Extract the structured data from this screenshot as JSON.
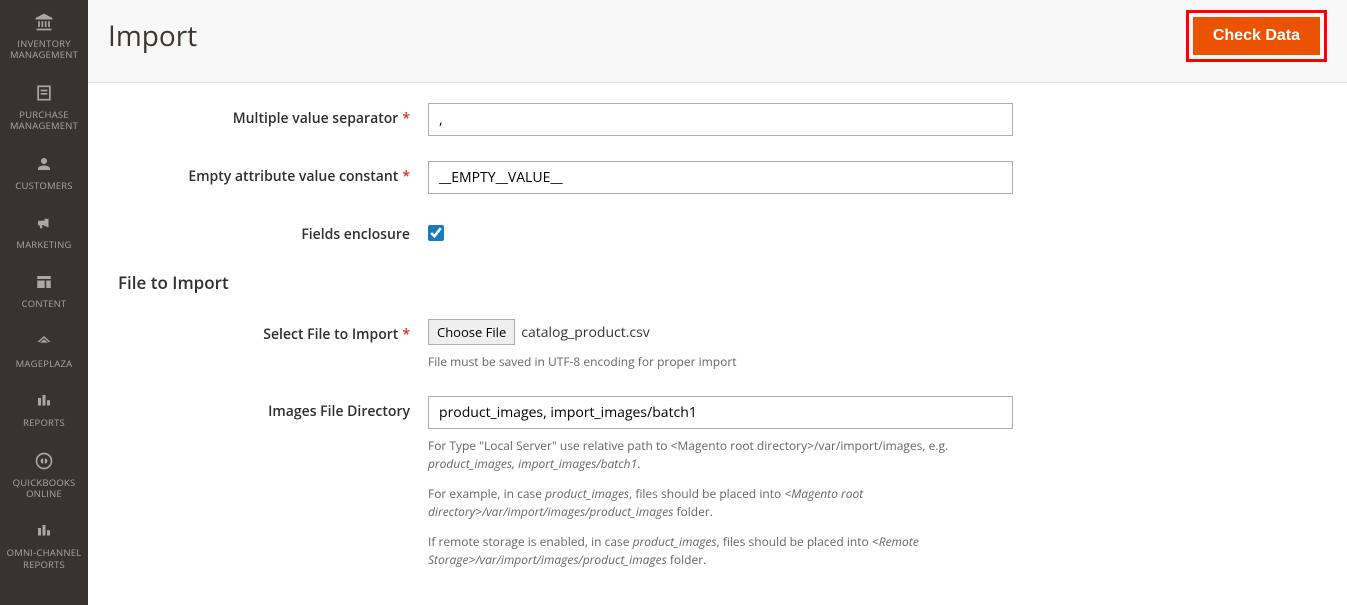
{
  "header": {
    "title": "Import",
    "check_data_label": "Check Data"
  },
  "sidebar": {
    "items": [
      {
        "label": "INVENTORY MANAGEMENT",
        "icon": "building-icon"
      },
      {
        "label": "PURCHASE MANAGEMENT",
        "icon": "document-icon"
      },
      {
        "label": "CUSTOMERS",
        "icon": "person-icon"
      },
      {
        "label": "MARKETING",
        "icon": "megaphone-icon"
      },
      {
        "label": "CONTENT",
        "icon": "layout-icon"
      },
      {
        "label": "MAGEPLAZA",
        "icon": "roof-icon"
      },
      {
        "label": "REPORTS",
        "icon": "chart-icon"
      },
      {
        "label": "QUICKBOOKS ONLINE",
        "icon": "qb-icon"
      },
      {
        "label": "OMNI-CHANNEL REPORTS",
        "icon": "chart-icon"
      }
    ]
  },
  "fields": {
    "multiple_value_separator": {
      "label": "Multiple value separator",
      "value": ","
    },
    "empty_attribute": {
      "label": "Empty attribute value constant",
      "value": "__EMPTY__VALUE__"
    },
    "fields_enclosure": {
      "label": "Fields enclosure"
    },
    "section_title": "File to Import",
    "select_file": {
      "label": "Select File to Import",
      "button": "Choose File",
      "filename": "catalog_product.csv",
      "help": "File must be saved in UTF-8 encoding for proper import"
    },
    "images_dir": {
      "label": "Images File Directory",
      "value": "product_images, import_images/batch1",
      "help1_a": "For Type \"Local Server\" use relative path to <Magento root directory>/var/import/images, e.g. ",
      "help1_b": "product_images, import_images/batch1",
      "help1_c": ".",
      "help2_a": "For example, in case ",
      "help2_b": "product_images",
      "help2_c": ", files should be placed into ",
      "help2_d": "<Magento root directory>/var/import/images/product_images",
      "help2_e": " folder.",
      "help3_a": "If remote storage is enabled, in case ",
      "help3_b": "product_images",
      "help3_c": ", files should be placed into ",
      "help3_d": "<Remote Storage>/var/import/images/product_images",
      "help3_e": " folder."
    }
  }
}
